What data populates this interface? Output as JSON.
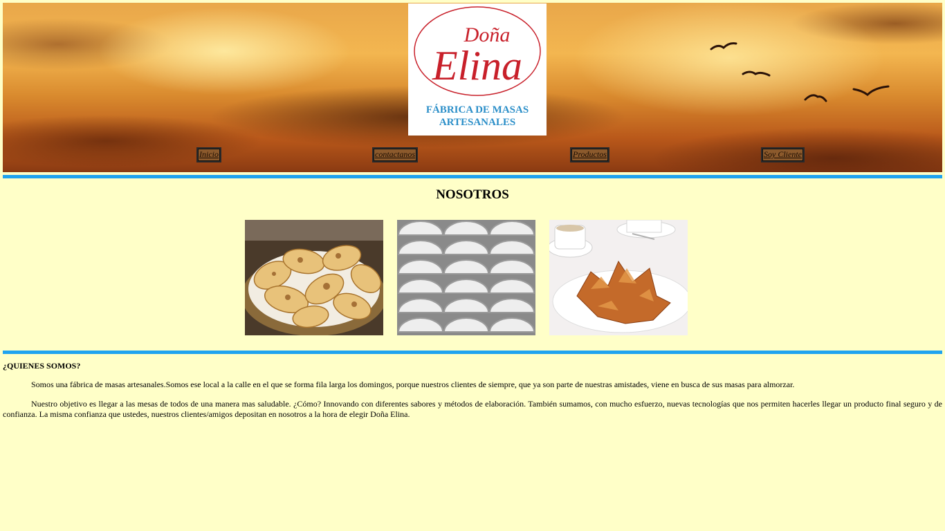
{
  "logo": {
    "brand_small": "Doña",
    "brand_large": "Elina",
    "tagline_line1": "FÁBRICA DE MASAS",
    "tagline_line2": "ARTESANALES"
  },
  "nav": {
    "items": [
      {
        "label": "Inicio"
      },
      {
        "label": "contactanos"
      },
      {
        "label": "Productos"
      },
      {
        "label": "Soy Cliente"
      }
    ]
  },
  "main": {
    "title": "NOSOTROS",
    "photos": [
      {
        "icon": "empanadas-basket-photo"
      },
      {
        "icon": "raw-empanadas-photo"
      },
      {
        "icon": "pastries-and-coffee-photo"
      }
    ]
  },
  "about": {
    "heading": "¿QUIENES SOMOS?",
    "paragraph1": "Somos una fábrica de masas artesanales.Somos ese local a la calle en el que se forma fila larga los domingos, porque nuestros clientes de siempre, que ya son parte de nuestras amistades, viene en busca de sus masas para almorzar.",
    "paragraph2": "Nuestro objetivo es llegar a las mesas de todos de una manera mas saludable. ¿Cómo? Innovando con diferentes sabores y métodos de elaboración. También sumamos, con mucho esfuerzo, nuevas tecnologías que nos permiten hacerles llegar un producto final seguro y de confianza. La misma confianza que ustedes, nuestros clientes/amigos depositan en nosotros a la hora de elegir Doña Elina."
  },
  "colors": {
    "page_background": "#ffffc8",
    "divider": "#1fa3ef",
    "logo_red": "#c8202a",
    "logo_blue": "#2a8ec8"
  }
}
